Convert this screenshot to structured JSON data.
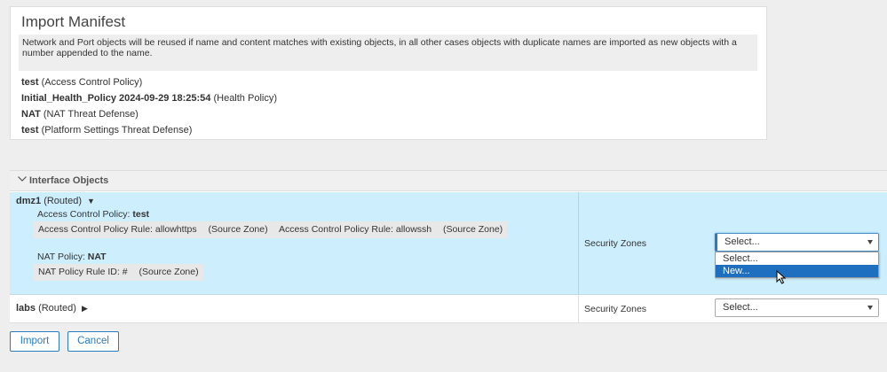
{
  "manifest": {
    "title": "Import Manifest",
    "note": "Network and Port objects will be reused if name and content matches with existing objects, in all other cases objects with duplicate names are imported as new objects with a number appended to the name.",
    "items": [
      {
        "name": "test",
        "type": "(Access Control Policy)"
      },
      {
        "name": "Initial_Health_Policy 2024-09-29 18:25:54",
        "type": "(Health Policy)"
      },
      {
        "name": "NAT",
        "type": "(NAT Threat Defense)"
      },
      {
        "name": "test",
        "type": "(Platform Settings Threat Defense)"
      }
    ]
  },
  "interface_objects": {
    "section_title": "Interface Objects",
    "rows": [
      {
        "name": "dmz1",
        "mode": "(Routed)",
        "expand_glyph": "▼",
        "acp_label": "Access Control Policy:",
        "acp_value": "test",
        "rule_chip": {
          "rule1": "Access Control Policy Rule: allowhttps",
          "rule1_zone": "(Source Zone)",
          "rule2": "Access Control Policy Rule: allowssh",
          "rule2_zone": "(Source Zone)"
        },
        "nat_label": "NAT Policy:",
        "nat_value": "NAT",
        "nat_chip": {
          "rule": "NAT Policy Rule ID: #",
          "zone": "(Source Zone)"
        },
        "zones_label": "Security Zones",
        "select_value": "Select...",
        "dropdown_options": [
          "Select...",
          "New..."
        ],
        "highlighted_option": "New..."
      },
      {
        "name": "labs",
        "mode": "(Routed)",
        "expand_glyph": "▶",
        "zones_label": "Security Zones",
        "select_value": "Select..."
      }
    ]
  },
  "buttons": {
    "import_label": "Import",
    "cancel_label": "Cancel"
  },
  "colors": {
    "accent": "#2b7bbf",
    "selected_row_bg": "#cdeefc",
    "dropdown_highlight": "#1f6fc0"
  }
}
